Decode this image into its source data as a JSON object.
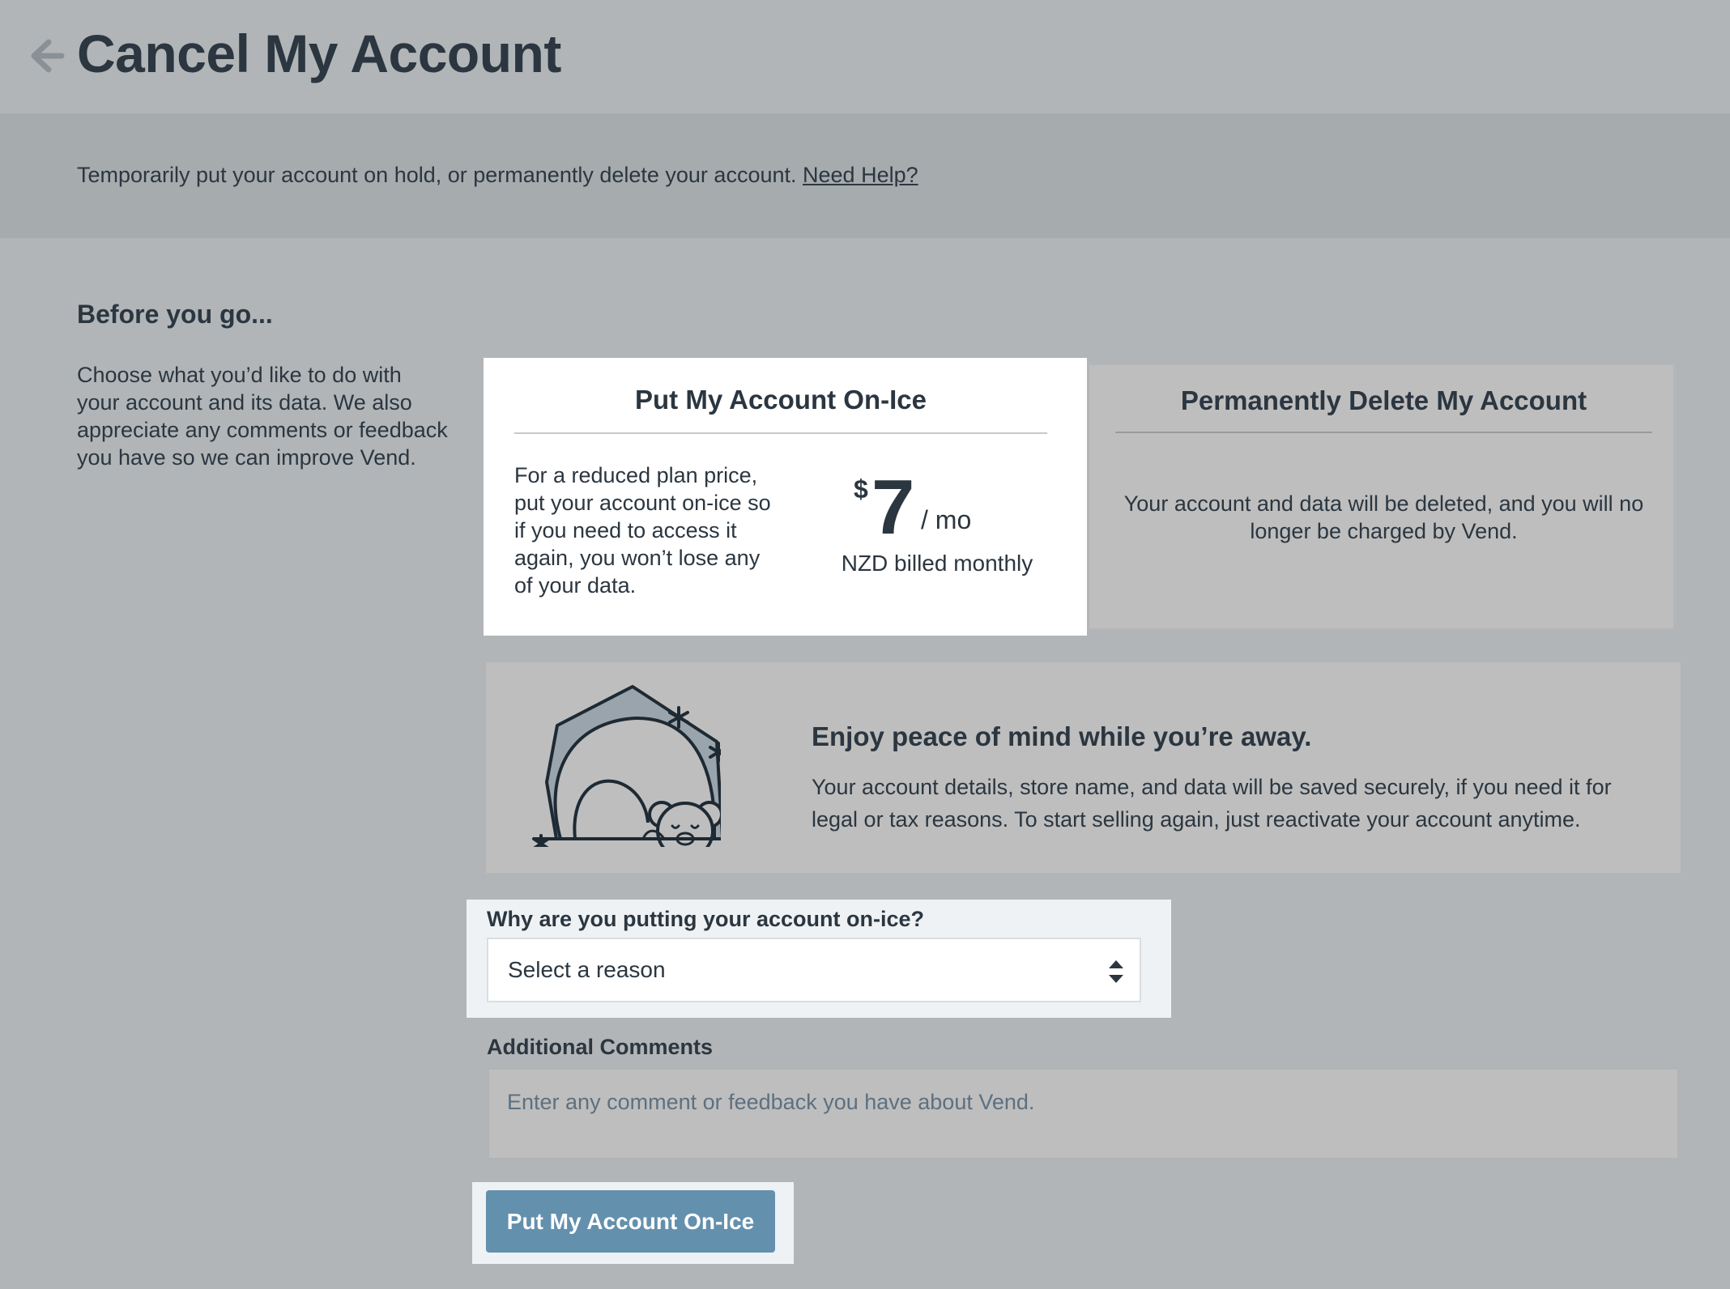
{
  "header": {
    "title": "Cancel My Account",
    "back_icon": "arrow-left-icon"
  },
  "info": {
    "text": "Temporarily put your account on hold, or permanently delete your account.",
    "help_link": "Need Help?"
  },
  "intro": {
    "title": "Before you go...",
    "text": "Choose what you’d like to do with your account and its data. We also appreciate any comments or feedback you have so we can improve Vend."
  },
  "options": {
    "ice": {
      "title": "Put My Account On-Ice",
      "description": "For a reduced plan price, put your account on-ice so if you need to access it again, you won’t lose any of your data.",
      "currency": "$",
      "amount": "7",
      "period": "/ mo",
      "billing": "NZD billed monthly"
    },
    "delete": {
      "title": "Permanently Delete My Account",
      "description": "Your account and data will be deleted, and you will no longer be charged by Vend."
    }
  },
  "peace": {
    "illustration_icon": "sleeping-bear-cave-icon",
    "title": "Enjoy peace of mind while you’re away.",
    "text": "Your account details, store name, and data will be saved securely, if you need it for legal or tax reasons. To start selling again, just reactivate your account anytime."
  },
  "form": {
    "reason_label": "Why are you putting your account on-ice?",
    "reason_value": "Select a reason",
    "comments_label": "Additional Comments",
    "comments_placeholder": "Enter any comment or feedback you have about Vend."
  },
  "submit": {
    "label": "Put My Account On-Ice"
  },
  "colors": {
    "background": "#b1b5b7",
    "band": "#a6abad",
    "primary_button": "#6390ad",
    "text": "#2b3640"
  }
}
